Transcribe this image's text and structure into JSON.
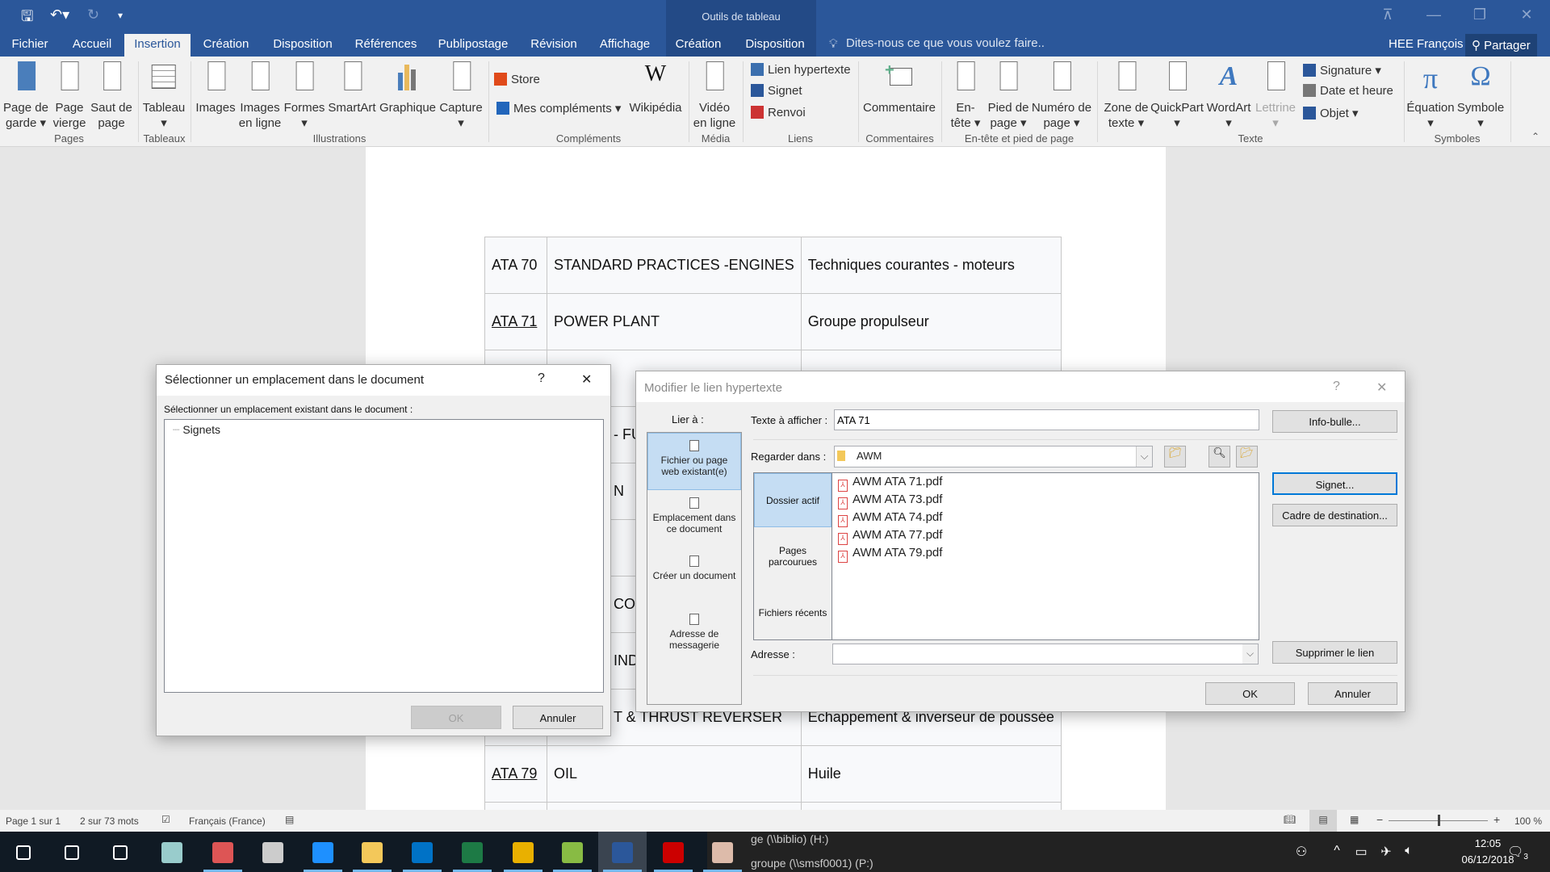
{
  "titlebar": {
    "context_group": "Outils de tableau",
    "tell_me": "Dites-nous ce que vous voulez faire..",
    "user": "HEE François",
    "share": "Partager",
    "tabs": [
      {
        "label": "Fichier"
      },
      {
        "label": "Accueil"
      },
      {
        "label": "Insertion",
        "active": true
      },
      {
        "label": "Création"
      },
      {
        "label": "Disposition"
      },
      {
        "label": "Références"
      },
      {
        "label": "Publipostage"
      },
      {
        "label": "Révision"
      },
      {
        "label": "Affichage"
      },
      {
        "label": "Création"
      },
      {
        "label": "Disposition"
      }
    ]
  },
  "ribbon": {
    "groups": [
      {
        "label": "Pages"
      },
      {
        "label": "Tableaux"
      },
      {
        "label": "Illustrations"
      },
      {
        "label": "Compléments"
      },
      {
        "label": "Média"
      },
      {
        "label": "Liens"
      },
      {
        "label": "Commentaires"
      },
      {
        "label": "En-tête et pied de page"
      },
      {
        "label": "Texte"
      },
      {
        "label": "Symboles"
      }
    ],
    "buttons": [
      {
        "l1": "Page de",
        "l2": "garde ▾",
        "icon": "cover-page-icon"
      },
      {
        "l1": "Page",
        "l2": "vierge",
        "icon": "blank-page-icon"
      },
      {
        "l1": "Saut de",
        "l2": "page",
        "icon": "page-break-icon"
      },
      {
        "l1": "Tableau",
        "l2": "▾",
        "icon": "table-icon"
      },
      {
        "l1": "Images",
        "l2": "",
        "icon": "pictures-icon"
      },
      {
        "l1": "Images",
        "l2": "en ligne",
        "icon": "online-pictures-icon"
      },
      {
        "l1": "Formes",
        "l2": "▾",
        "icon": "shapes-icon"
      },
      {
        "l1": "SmartArt",
        "l2": "",
        "icon": "smartart-icon"
      },
      {
        "l1": "Graphique",
        "l2": "",
        "icon": "chart-icon"
      },
      {
        "l1": "Capture",
        "l2": "▾",
        "icon": "screenshot-icon"
      },
      {
        "l1": "Wikipédia",
        "l2": "",
        "icon": "wikipedia-icon"
      },
      {
        "l1": "Vidéo",
        "l2": "en ligne",
        "icon": "online-video-icon"
      },
      {
        "l1": "Commentaire",
        "l2": "",
        "icon": "comment-icon"
      },
      {
        "l1": "En-",
        "l2": "tête ▾",
        "icon": "header-icon"
      },
      {
        "l1": "Pied de",
        "l2": "page ▾",
        "icon": "footer-icon"
      },
      {
        "l1": "Numéro de",
        "l2": "page ▾",
        "icon": "page-number-icon"
      },
      {
        "l1": "Zone de",
        "l2": "texte ▾",
        "icon": "text-box-icon"
      },
      {
        "l1": "QuickPart",
        "l2": "▾",
        "icon": "quickpart-icon"
      },
      {
        "l1": "WordArt",
        "l2": "▾",
        "icon": "wordart-icon"
      },
      {
        "l1": "Lettrine",
        "l2": "▾",
        "icon": "drop-cap-icon",
        "disabled": true
      },
      {
        "l1": "Équation",
        "l2": "▾",
        "icon": "equation-icon"
      },
      {
        "l1": "Symbole",
        "l2": "▾",
        "icon": "symbol-icon"
      }
    ],
    "small": [
      {
        "label": "Store",
        "icon": "store-icon"
      },
      {
        "label": "Mes compléments  ▾",
        "icon": "my-addins-icon"
      },
      {
        "label": "Lien hypertexte",
        "icon": "hyperlink-icon"
      },
      {
        "label": "Signet",
        "icon": "bookmark-icon"
      },
      {
        "label": "Renvoi",
        "icon": "cross-reference-icon"
      },
      {
        "label": "Signature  ▾",
        "icon": "signature-icon"
      },
      {
        "label": "Date et heure",
        "icon": "date-time-icon"
      },
      {
        "label": "Objet  ▾",
        "icon": "object-icon"
      }
    ]
  },
  "document": {
    "rows": [
      [
        "ATA 70",
        "STANDARD PRACTICES -ENGINES",
        "Techniques courantes - moteurs"
      ],
      [
        "ATA 71",
        "POWER PLANT",
        "Groupe propulseur"
      ],
      [
        "",
        "",
        ""
      ],
      [
        "",
        "- FU",
        ""
      ],
      [
        "",
        "N",
        ""
      ],
      [
        "",
        "",
        ""
      ],
      [
        "",
        "CON",
        ""
      ],
      [
        "",
        "IND",
        ""
      ],
      [
        "",
        "T & THRUST REVERSER",
        "Echappement & inverseur de poussée"
      ],
      [
        "ATA 79",
        "OIL",
        "Huile"
      ],
      [
        "",
        "",
        ""
      ]
    ]
  },
  "select_dialog": {
    "title": "Sélectionner un emplacement dans le document",
    "help": "?",
    "close": "✕",
    "prompt": "Sélectionner un emplacement existant dans le document :",
    "tree_root": "Signets",
    "ok": "OK",
    "cancel": "Annuler"
  },
  "link_dialog": {
    "title": "Modifier le lien hypertexte",
    "help": "?",
    "close": "✕",
    "link_to": "Lier à :",
    "link_types": [
      "Fichier ou page web existant(e)",
      "Emplacement dans ce document",
      "Créer un document",
      "Adresse de messagerie"
    ],
    "text_label": "Texte à afficher :",
    "text_value": "ATA 71",
    "tooltip_btn": "Info-bulle...",
    "look_in_label": "Regarder dans :",
    "look_in_value": "AWM",
    "nav": [
      "Dossier actif",
      "Pages parcourues",
      "Fichiers récents"
    ],
    "files": [
      "AWM ATA 71.pdf",
      "AWM ATA 73.pdf",
      "AWM ATA 74.pdf",
      "AWM ATA 77.pdf",
      "AWM ATA 79.pdf"
    ],
    "bookmark_btn": "Signet...",
    "target_frame_btn": "Cadre de destination...",
    "address_label": "Adresse :",
    "address_value": "",
    "remove_link_btn": "Supprimer le lien",
    "ok": "OK",
    "cancel": "Annuler"
  },
  "statusbar": {
    "page": "Page 1 sur 1",
    "words": "2 sur 73 mots",
    "language": "Français (France)",
    "zoom": "100 %",
    "zoom_percent": 100
  },
  "taskbar": {
    "overlay1": "ge (\\\\biblio) (H:)",
    "overlay2": "groupe (\\\\smsf0001) (P:)",
    "time": "12:05",
    "date": "06/12/2018",
    "notifications": "3",
    "apps": [
      "start",
      "search",
      "task-view",
      "app-1",
      "app-2",
      "app-3",
      "internet-explorer",
      "file-explorer",
      "outlook",
      "excel",
      "chrome",
      "app-4",
      "word",
      "acrobat",
      "paint"
    ]
  },
  "colors": {
    "brand": "#2b579a",
    "selection": "#c5ddf3",
    "focus": "#0078d7"
  }
}
